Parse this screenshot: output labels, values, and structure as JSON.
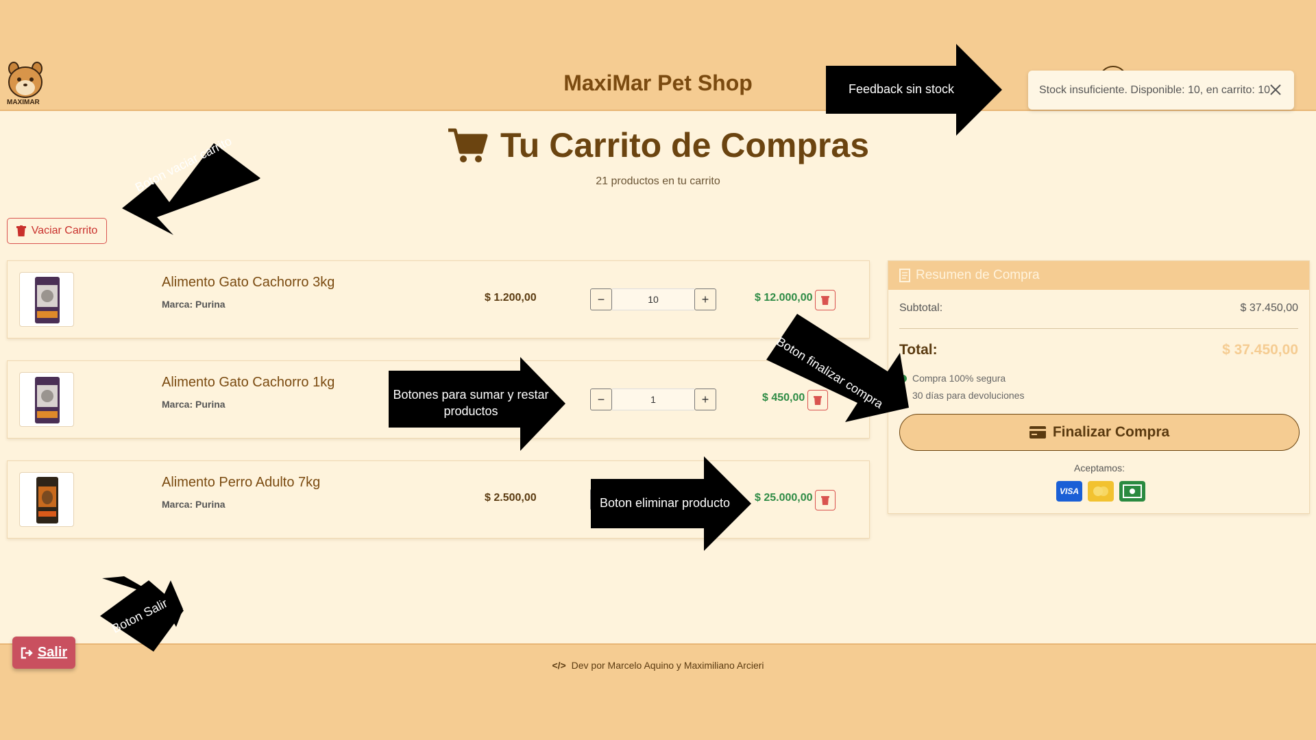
{
  "header": {
    "logo_label": "MAXIMAR",
    "brand": "MaxiMar Pet Shop"
  },
  "toast": {
    "message": "Stock insuficiente. Disponible: 10, en carrito: 10"
  },
  "page": {
    "title": "Tu Carrito de Compras",
    "subtitle": "21 productos en tu carrito"
  },
  "cart_actions": {
    "empty_label": "Vaciar Carrito"
  },
  "items": [
    {
      "name": "Alimento Gato Cachorro 3kg",
      "brand_label": "Marca: Purina",
      "unit_price": "$ 1.200,00",
      "quantity": "10",
      "total": "$ 12.000,00"
    },
    {
      "name": "Alimento Gato Cachorro 1kg",
      "brand_label": "Marca: Purina",
      "unit_price": "",
      "quantity": "1",
      "total": "$ 450,00"
    },
    {
      "name": "Alimento Perro Adulto 7kg",
      "brand_label": "Marca: Purina",
      "unit_price": "$ 2.500,00",
      "quantity": "",
      "total": "$ 25.000,00"
    }
  ],
  "summary": {
    "title": "Resumen de Compra",
    "subtotal_label": "Subtotal:",
    "subtotal_value": "$ 37.450,00",
    "total_label": "Total:",
    "total_value": "$ 37.450,00",
    "features": [
      "Compra 100% segura",
      "30 días para devoluciones"
    ],
    "checkout_label": "Finalizar Compra",
    "accept_label": "Aceptamos:",
    "payment_icons": [
      "visa-icon",
      "mastercard-icon",
      "cash-icon"
    ]
  },
  "footer": {
    "credit": "Dev por Marcelo Aquino y Maximiliano Arcieri",
    "exit_label": "Salir"
  },
  "annotations": {
    "stock_feedback": "Feedback sin stock",
    "empty_cart": "Boton vaciar carrito",
    "qty_buttons": [
      "Botones para sumar y restar",
      "productos"
    ],
    "checkout": "Boton finalizar compra",
    "delete_product": "Boton eliminar producto",
    "exit": "Boton Salir"
  },
  "colors": {
    "band": "#f5cc92",
    "background": "#fef3dc",
    "accent_brown": "#6b4410",
    "price_green": "#2e8b45",
    "danger_red": "#d9534f",
    "exit_button": "#c9505f"
  }
}
